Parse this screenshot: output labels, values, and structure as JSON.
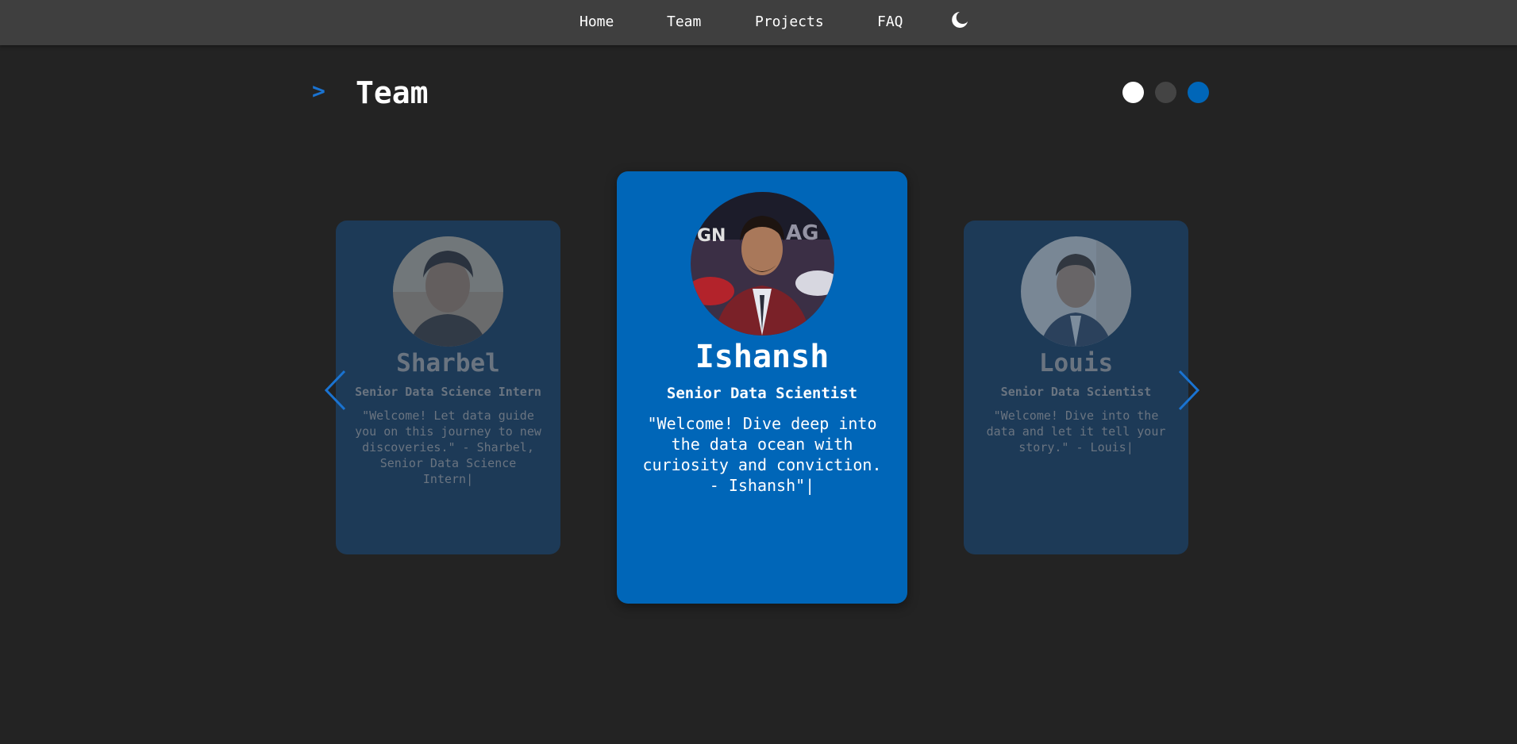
{
  "nav": {
    "links": [
      "Home",
      "Team",
      "Projects",
      "FAQ"
    ],
    "theme_toggle_icon": "moon-icon"
  },
  "section": {
    "arrow": ">",
    "title": "Team"
  },
  "pagination": {
    "count": 3,
    "active_index": 2,
    "colors": [
      "#ffffff",
      "#444444",
      "#0066b8"
    ]
  },
  "cards": [
    {
      "name": "Sharbel",
      "role": "Senior Data Science Intern",
      "quote": "\"Welcome! Let data guide you on this journey to new discoveries.\" - Sharbel, Senior Data Science Intern|"
    },
    {
      "name": "Ishansh",
      "role": "Senior Data Scientist",
      "quote": "\"Welcome! Dive deep into the data ocean with curiosity and conviction. - Ishansh\"|"
    },
    {
      "name": "Louis",
      "role": "Senior Data Scientist",
      "quote": "\"Welcome! Dive into the data and let it tell your story.\" - Louis|"
    }
  ],
  "colors": {
    "background": "#232323",
    "navbar": "#3f3f3f",
    "accent": "#0066b8",
    "side_card": "#1d3a57"
  },
  "icons": {
    "prev": "chevron-left-icon",
    "next": "chevron-right-icon"
  }
}
